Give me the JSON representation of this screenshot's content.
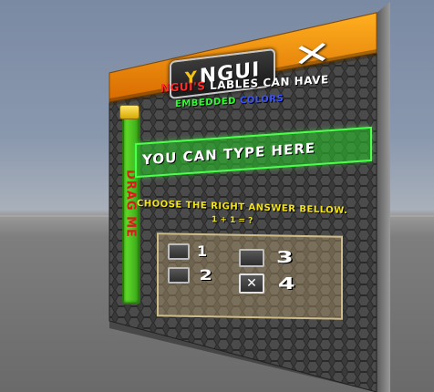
{
  "header": {
    "logo_text": "NGUI",
    "logo_mark": "Y",
    "close_glyph": "✕"
  },
  "embedded": {
    "line1_red": "NGUI'S",
    "line1_rest": " LABLES CAN HAVE",
    "line2_green": "EMBEDDED ",
    "line2_blue": "COLORS"
  },
  "drag": {
    "label": "DRAG ME"
  },
  "input": {
    "value": "YOU CAN TYPE HERE"
  },
  "quiz": {
    "question": "CHOOSE THE RIGHT ANSWER BELLOW.",
    "equation": "1 + 1 = ?",
    "options": [
      {
        "label": "1",
        "checked": false,
        "mark": ""
      },
      {
        "label": "3",
        "checked": false,
        "mark": ""
      },
      {
        "label": "2",
        "checked": false,
        "mark": ""
      },
      {
        "label": "4",
        "checked": true,
        "mark": "✕"
      }
    ]
  },
  "colors": {
    "header_orange": "#f08a00",
    "input_green": "#4cff4c",
    "question_yellow": "#f2e31a",
    "drag_red": "#d81b1b"
  }
}
